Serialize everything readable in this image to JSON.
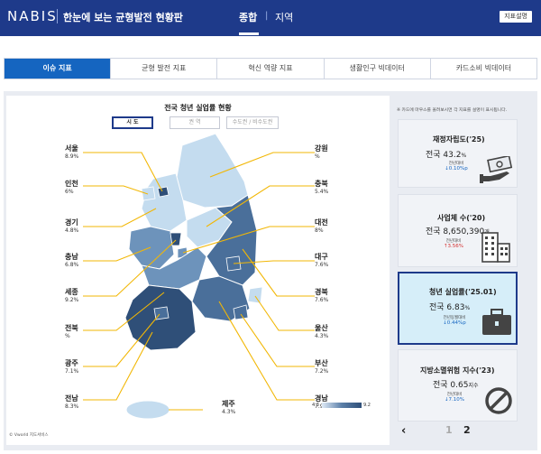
{
  "header": {
    "logo": "NABIS",
    "title": "한눈에 보는 균형발전 현황판",
    "nav": [
      "종합",
      "지역"
    ],
    "nav_sep": "|",
    "guide_button": "지표설명"
  },
  "tabs": [
    "이슈 지표",
    "균형 발전 지표",
    "혁신 역량 지표",
    "생활인구 빅데이터",
    "카드소비 빅데이터"
  ],
  "map": {
    "title": "전국 청년 실업률 현황",
    "levels": [
      "시 도",
      "권 역",
      "수도권 / 비수도권"
    ],
    "regions": [
      {
        "name": "서울",
        "value": "8.9%"
      },
      {
        "name": "인천",
        "value": "6%"
      },
      {
        "name": "경기",
        "value": "4.8%"
      },
      {
        "name": "충남",
        "value": "6.8%"
      },
      {
        "name": "세종",
        "value": "9.2%"
      },
      {
        "name": "전북",
        "value": "%"
      },
      {
        "name": "광주",
        "value": "7.1%"
      },
      {
        "name": "전남",
        "value": "8.3%"
      },
      {
        "name": "제주",
        "value": "4.3%"
      },
      {
        "name": "강원",
        "value": "%"
      },
      {
        "name": "충북",
        "value": "5.4%"
      },
      {
        "name": "대전",
        "value": "8%"
      },
      {
        "name": "대구",
        "value": "7.6%"
      },
      {
        "name": "경북",
        "value": "7.6%"
      },
      {
        "name": "울산",
        "value": "4.3%"
      },
      {
        "name": "부산",
        "value": "7.2%"
      },
      {
        "name": "경남",
        "value": "7.9%"
      }
    ],
    "copyright": "© Vworld 지도서비스",
    "legend": {
      "min": "4.3",
      "max": "9.2"
    },
    "colors": {
      "light": "#c4dcef",
      "mid": "#6d93bb",
      "dark": "#4a6f9a",
      "darkest": "#2f4f78",
      "leader": "#f2b705"
    }
  },
  "sidebar": {
    "note": "※ 카드에 마우스를 올려보시면 각 지표를 설명이 표시됩니다.",
    "cards": [
      {
        "title": "재정자립도('25)",
        "value": "전국 43.2",
        "unit": "%",
        "sub": "전년대비",
        "delta": "↓0.10%p",
        "icon": "money-hand-icon"
      },
      {
        "title": "사업체 수('20)",
        "value": "전국 8,650,390",
        "unit": "개",
        "sub": "전년대비",
        "delta": "↑3.56%",
        "icon": "building-icon"
      },
      {
        "title": "청년 실업률('25.01)",
        "value": "전국 6.83",
        "unit": "%",
        "sub": "전년동월대비",
        "delta": "↓0.44%p",
        "icon": "briefcase-icon"
      },
      {
        "title": "지방소멸위험 지수('23)",
        "value": "전국 0.65",
        "unit": "지수",
        "sub": "전년대비",
        "delta": "↓7.10%",
        "icon": "prohibited-icon"
      }
    ],
    "pager": {
      "prev": "‹",
      "pages": [
        "1",
        "2"
      ]
    }
  }
}
